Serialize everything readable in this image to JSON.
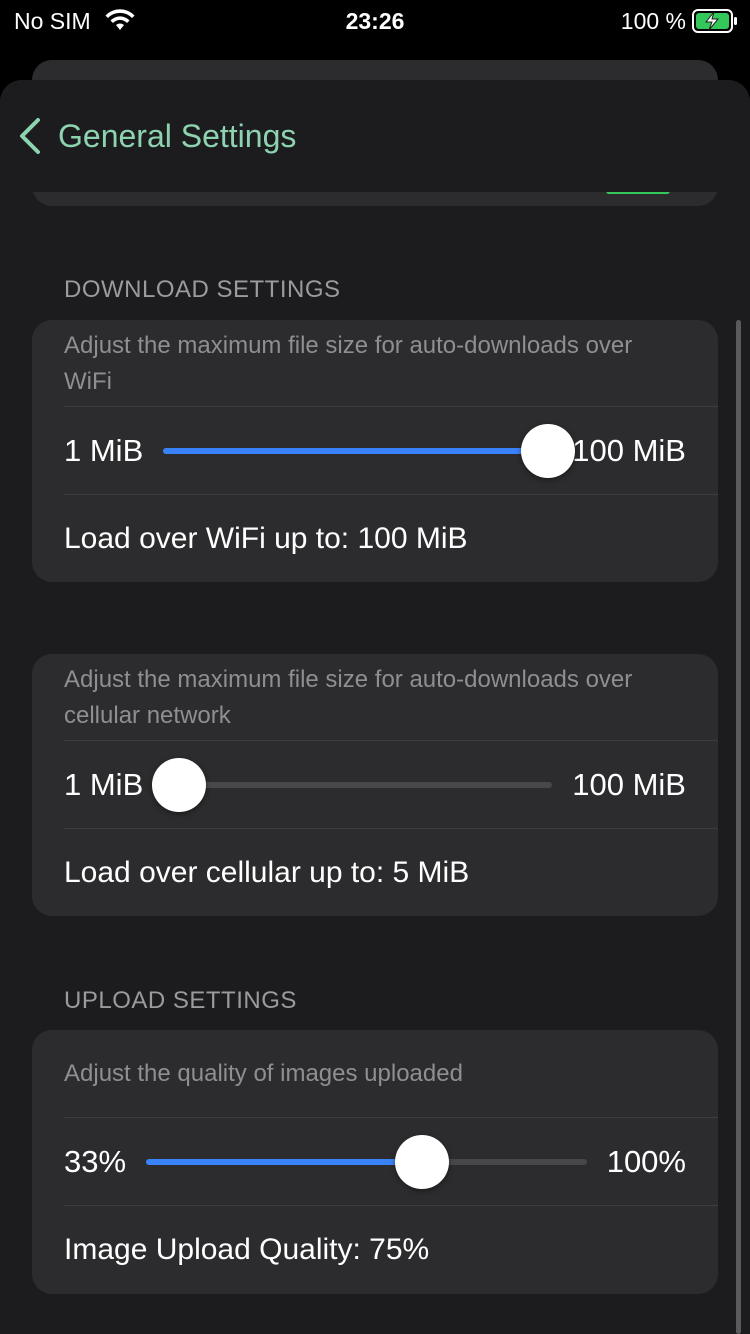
{
  "status_bar": {
    "carrier": "No SIM",
    "time": "23:26",
    "battery_percent": "100 %"
  },
  "nav": {
    "back_label": "General Settings",
    "accent_color": "#8ed3b0"
  },
  "download": {
    "header": "DOWNLOAD SETTINGS",
    "wifi": {
      "description": "Adjust the maximum file size for auto-downloads over WiFi",
      "min_label": "1 MiB",
      "max_label": "100 MiB",
      "slider_fraction": 0.99,
      "value_text": "Load over WiFi up to: 100 MiB"
    },
    "cellular": {
      "description": "Adjust the maximum file size for auto-downloads over cellular network",
      "min_label": "1 MiB",
      "max_label": "100 MiB",
      "slider_fraction": 0.04,
      "value_text": "Load over cellular up to: 5 MiB"
    }
  },
  "upload": {
    "header": "UPLOAD SETTINGS",
    "quality": {
      "description": "Adjust the quality of images uploaded",
      "min_label": "33%",
      "max_label": "100%",
      "slider_fraction": 0.627,
      "value_text": "Image Upload Quality: 75%"
    }
  },
  "colors": {
    "slider_fill": "#3a82f7",
    "background": "#1c1c1e",
    "card": "#2c2c2e"
  }
}
